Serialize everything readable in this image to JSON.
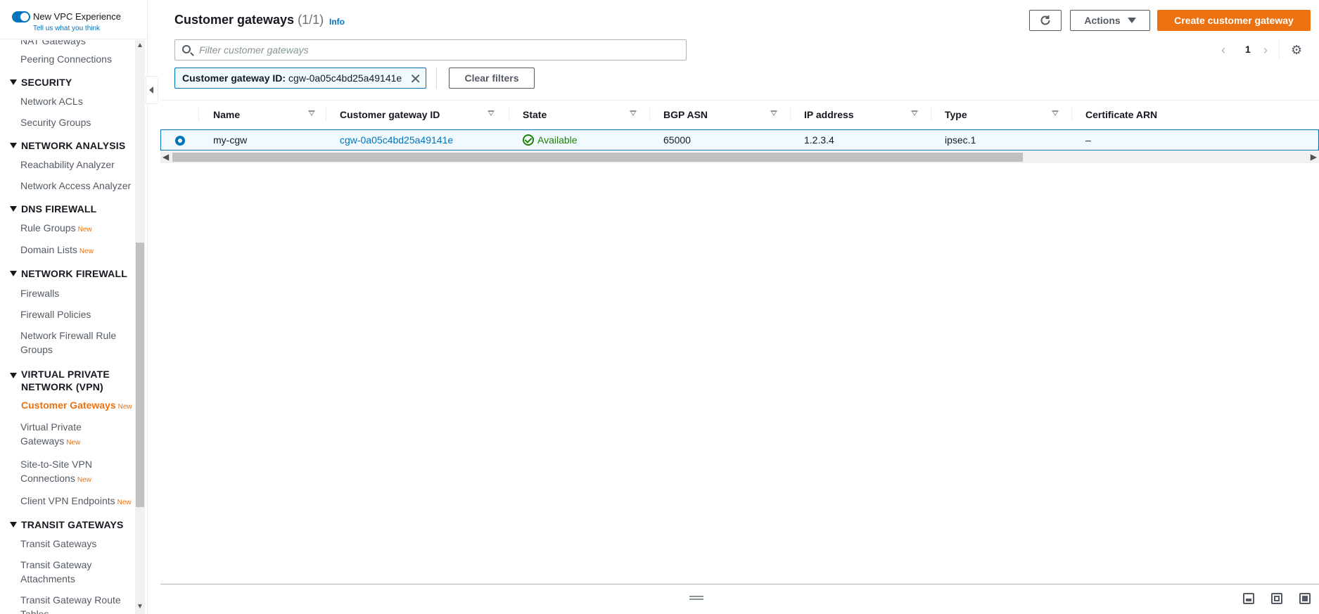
{
  "sidebar": {
    "toggle_label": "New VPC Experience",
    "feedback_link": "Tell us what you think",
    "cut_item": "NAT Gateways",
    "items": {
      "peering": "Peering Connections",
      "security_header": "SECURITY",
      "network_acls": "Network ACLs",
      "security_groups": "Security Groups",
      "network_analysis_header": "NETWORK ANALYSIS",
      "reachability_analyzer": "Reachability Analyzer",
      "network_access_analyzer": "Network Access Analyzer",
      "dns_firewall_header": "DNS FIREWALL",
      "rule_groups": "Rule Groups",
      "domain_lists": "Domain Lists",
      "network_firewall_header": "NETWORK FIREWALL",
      "firewalls": "Firewalls",
      "firewall_policies": "Firewall Policies",
      "nf_rule_groups_line1": "Network Firewall Rule",
      "nf_rule_groups_line2": "Groups",
      "vpn_header_line1": "VIRTUAL PRIVATE",
      "vpn_header_line2": "NETWORK (VPN)",
      "customer_gateways": "Customer Gateways",
      "vpg_line1": "Virtual Private",
      "vpg_line2": "Gateways",
      "s2s_line1": "Site-to-Site VPN",
      "s2s_line2": "Connections",
      "client_vpn": "Client VPN Endpoints",
      "transit_header": "TRANSIT GATEWAYS",
      "transit_gateways": "Transit Gateways",
      "tga_line1": "Transit Gateway",
      "tga_line2": "Attachments",
      "tgrt_line1": "Transit Gateway Route",
      "tgrt_line2": "Tables"
    },
    "new_badge": "New"
  },
  "header": {
    "title": "Customer gateways",
    "count": "(1/1)",
    "info": "Info",
    "actions_label": "Actions",
    "create_label": "Create customer gateway"
  },
  "search": {
    "placeholder": "Filter customer gateways"
  },
  "pagination": {
    "current_page": "1"
  },
  "filter": {
    "token_key": "Customer gateway ID:",
    "token_value": "cgw-0a05c4bd25a49141e",
    "clear_label": "Clear filters"
  },
  "table": {
    "columns": [
      "Name",
      "Customer gateway ID",
      "State",
      "BGP ASN",
      "IP address",
      "Type",
      "Certificate ARN"
    ],
    "rows": [
      {
        "name": "my-cgw",
        "id": "cgw-0a05c4bd25a49141e",
        "state": "Available",
        "bgp_asn": "65000",
        "ip": "1.2.3.4",
        "type": "ipsec.1",
        "cert": "–"
      }
    ]
  },
  "colors": {
    "accent": "#0073bb",
    "primary_button": "#ec7211",
    "status_ok": "#1d8102"
  }
}
